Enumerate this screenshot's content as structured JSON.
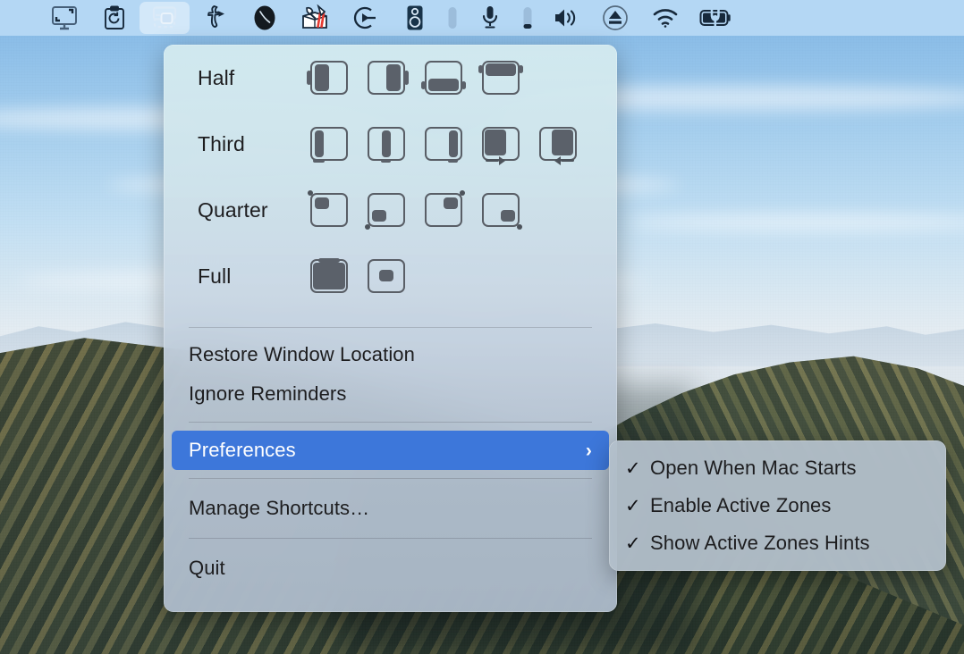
{
  "menubar": {
    "items": [
      {
        "name": "display-capture-icon",
        "label": "Screen Capture"
      },
      {
        "name": "clipboard-history-icon",
        "label": "Clipboard History"
      },
      {
        "name": "window-tiler-icon",
        "label": "Window Tiler",
        "active": true
      },
      {
        "name": "typinator-icon",
        "label": "Typinator"
      },
      {
        "name": "moon-phase-icon",
        "label": "Dark Mode"
      },
      {
        "name": "toolbox-icon",
        "label": "Utilities"
      },
      {
        "name": "elgato-icon",
        "label": "Elgato Control Center"
      },
      {
        "name": "speaker-device-icon",
        "label": "Output Device"
      },
      {
        "name": "output-level-meter",
        "label": "Output Level"
      },
      {
        "name": "microphone-icon",
        "label": "Input Device"
      },
      {
        "name": "input-level-meter",
        "label": "Input Level"
      },
      {
        "name": "volume-icon",
        "label": "Volume"
      },
      {
        "name": "eject-icon",
        "label": "Eject"
      },
      {
        "name": "wifi-icon",
        "label": "Wi-Fi"
      },
      {
        "name": "battery-charging-icon",
        "label": "Battery"
      }
    ]
  },
  "menu": {
    "layout_rows": [
      {
        "label": "Half",
        "tiles": [
          "half-left",
          "half-right",
          "half-bottom",
          "half-top"
        ]
      },
      {
        "label": "Third",
        "tiles": [
          "third-left",
          "third-center",
          "third-right",
          "two-third-left",
          "two-third-right"
        ]
      },
      {
        "label": "Quarter",
        "tiles": [
          "quarter-top-left",
          "quarter-bottom-left",
          "quarter-top-right",
          "quarter-bottom-right"
        ]
      },
      {
        "label": "Full",
        "tiles": [
          "full-screen",
          "center-window"
        ]
      }
    ],
    "items": [
      {
        "name": "restore-window-location",
        "label": "Restore Window Location",
        "selected": false
      },
      {
        "name": "ignore-reminders",
        "label": "Ignore Reminders",
        "selected": false
      },
      {
        "name": "preferences",
        "label": "Preferences",
        "selected": true,
        "submenu_chevron": "›"
      },
      {
        "name": "manage-shortcuts",
        "label": "Manage Shortcuts…",
        "selected": false
      },
      {
        "name": "quit",
        "label": "Quit",
        "selected": false
      }
    ]
  },
  "submenu": {
    "checkmark": "✓",
    "items": [
      {
        "name": "open-when-mac-starts",
        "label": "Open When Mac Starts",
        "checked": true
      },
      {
        "name": "enable-active-zones",
        "label": "Enable Active Zones",
        "checked": true
      },
      {
        "name": "show-active-zones-hints",
        "label": "Show Active Zones Hints",
        "checked": true
      }
    ]
  },
  "colors": {
    "menubar_bg": "#b4d7f4",
    "highlight_blue": "#3d77da",
    "menu_text": "#1d1d1f",
    "tile_fill": "#5b616a",
    "tile_stroke": "#595e66"
  }
}
